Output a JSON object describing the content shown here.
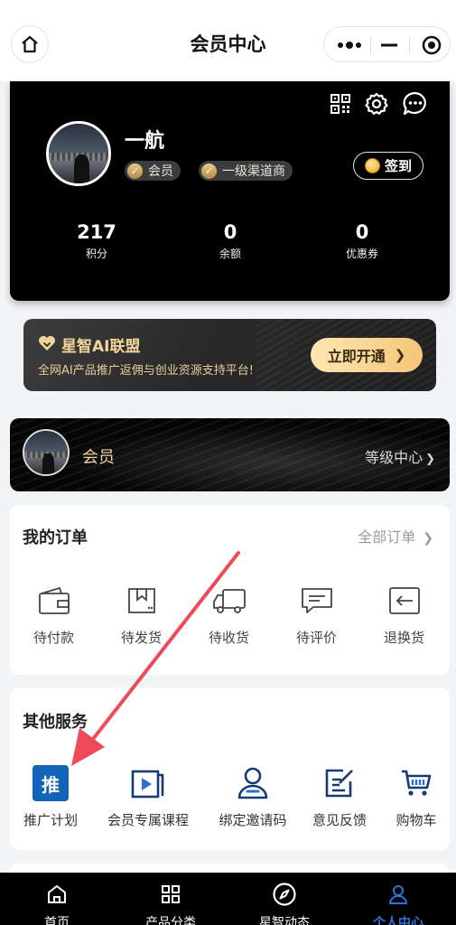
{
  "header": {
    "title": "会员中心"
  },
  "profile": {
    "name": "一航",
    "badges": [
      "会员",
      "一级渠道商"
    ],
    "checkin_label": "签到",
    "stats": [
      {
        "value": "217",
        "label": "积分"
      },
      {
        "value": "0",
        "label": "余额"
      },
      {
        "value": "0",
        "label": "优惠券"
      }
    ]
  },
  "ai_banner": {
    "title": "星智AI联盟",
    "subtitle": "全网AI产品推广返佣与创业资源支持平台!",
    "button": "立即开通"
  },
  "level": {
    "name": "会员",
    "link": "等级中心"
  },
  "orders": {
    "title": "我的订单",
    "all_label": "全部订单",
    "items": [
      "待付款",
      "待发货",
      "待收货",
      "待评价",
      "退换货"
    ]
  },
  "services": {
    "title": "其他服务",
    "promo_glyph": "推",
    "items": [
      "推广计划",
      "会员专属课程",
      "绑定邀请码",
      "意见反馈",
      "购物车"
    ]
  },
  "tabbar": {
    "items": [
      "首页",
      "产品分类",
      "星智动态",
      "个人中心"
    ],
    "active": "个人中心"
  },
  "colors": {
    "accent": "#2f73d9",
    "gold": "#f1d49a",
    "annotation_arrow": "#ee4a5a"
  }
}
